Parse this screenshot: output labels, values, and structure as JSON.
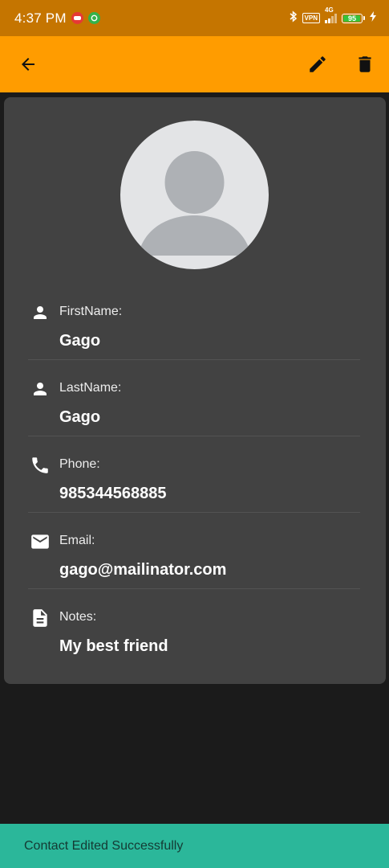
{
  "status_bar": {
    "time": "4:37 PM",
    "vpn": "VPN",
    "network": "4G",
    "battery": "95",
    "battery_level": 0.95
  },
  "app_bar": {
    "icons": {
      "back": "arrow-back-icon",
      "edit": "pencil-icon",
      "delete": "trash-icon"
    },
    "background": "#ff9c00"
  },
  "contact": {
    "fields": [
      {
        "icon": "person-icon",
        "label": "FirstName:",
        "value": "Gago"
      },
      {
        "icon": "person-icon",
        "label": "LastName:",
        "value": "Gago"
      },
      {
        "icon": "phone-icon",
        "label": "Phone:",
        "value": "985344568885"
      },
      {
        "icon": "email-icon",
        "label": "Email:",
        "value": "gago@mailinator.com"
      },
      {
        "icon": "document-icon",
        "label": "Notes:",
        "value": "My best friend"
      }
    ]
  },
  "snackbar": {
    "message": "Contact Edited Successfully",
    "background": "#2bb79a"
  }
}
